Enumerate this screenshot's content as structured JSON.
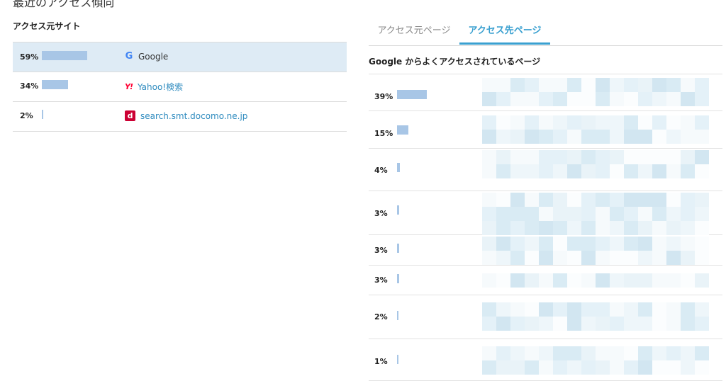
{
  "page_title": "最近のアクセス傾向",
  "sources": {
    "label": "アクセス元サイト",
    "rows": [
      {
        "percent": "59%",
        "share": 0.59,
        "icon": "google-icon",
        "glyph": "G",
        "name": "Google",
        "selected": true
      },
      {
        "percent": "34%",
        "share": 0.34,
        "icon": "yahoo-icon",
        "glyph": "Y!",
        "name": "Yahoo!検索",
        "selected": false
      },
      {
        "percent": "2%",
        "share": 0.02,
        "icon": "docomo-icon",
        "glyph": "d",
        "name": "search.smt.docomo.ne.jp",
        "selected": false
      }
    ]
  },
  "tabs": [
    {
      "label": "アクセス元ページ",
      "active": false
    },
    {
      "label": "アクセス先ページ",
      "active": true
    }
  ],
  "destinations": {
    "heading": "Google からよくアクセスされているページ",
    "rows": [
      {
        "percent": "39%",
        "share": 0.39
      },
      {
        "percent": "15%",
        "share": 0.15
      },
      {
        "percent": "4%",
        "share": 0.04
      },
      {
        "percent": "3%",
        "share": 0.03
      },
      {
        "percent": "3%",
        "share": 0.03
      },
      {
        "percent": "3%",
        "share": 0.03
      },
      {
        "percent": "2%",
        "share": 0.02
      },
      {
        "percent": "1%",
        "share": 0.01
      }
    ]
  },
  "colors": {
    "bar": "#a8c6e6",
    "selected_row": "#deebf5",
    "link": "#2e8bbf",
    "active_tab": "#3aa0d0"
  }
}
